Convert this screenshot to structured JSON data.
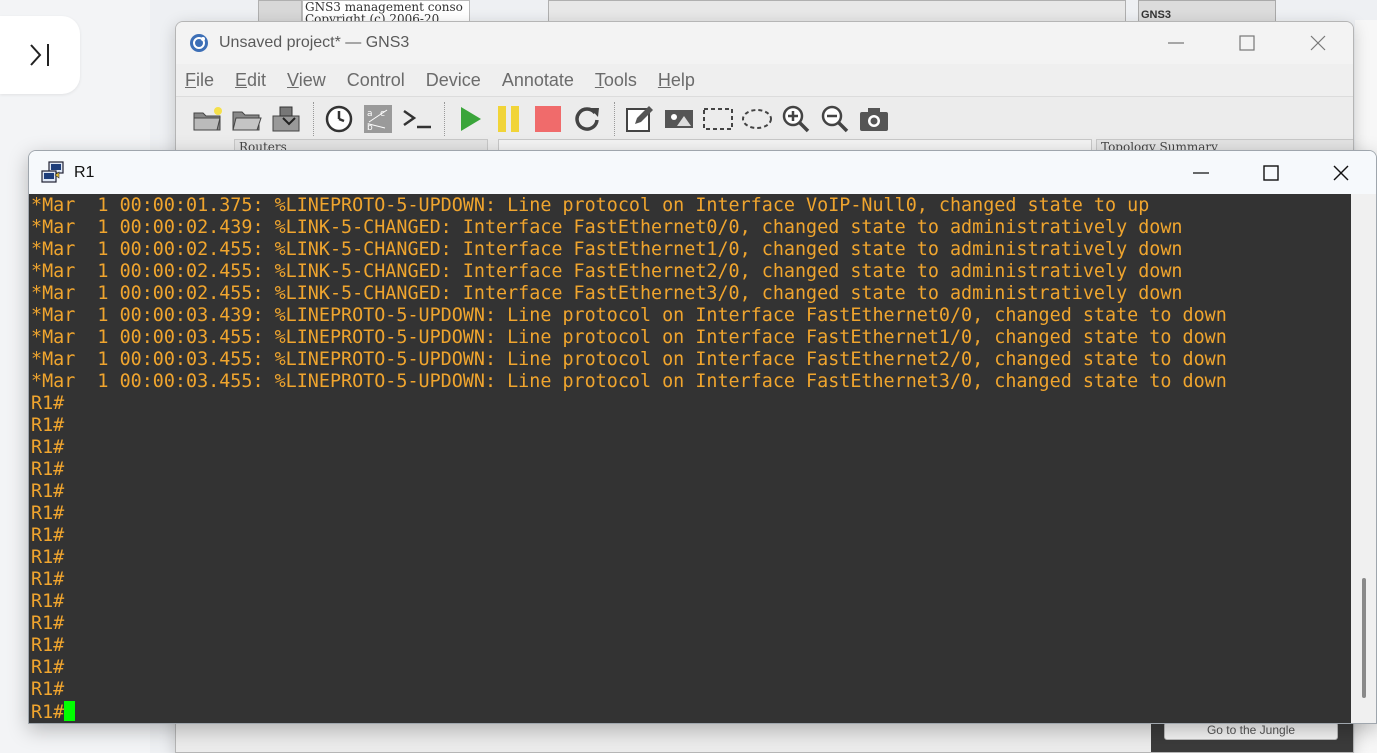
{
  "background": {
    "console_snippet_lines": [
      "GNS3 management conso",
      "Copyright (c) 2006-20"
    ],
    "gns3_badge": "GNS3",
    "sidebar_toggle_icon": "collapse-panel-icon"
  },
  "gns3_window": {
    "title": "Unsaved project* — GNS3",
    "menu": [
      {
        "first": "F",
        "rest": "ile"
      },
      {
        "first": "E",
        "rest": "dit"
      },
      {
        "first": "V",
        "rest": "iew"
      },
      {
        "first": "",
        "rest": "Control"
      },
      {
        "first": "",
        "rest": "Device"
      },
      {
        "first": "",
        "rest": "Annotate"
      },
      {
        "first": "T",
        "rest": "ools"
      },
      {
        "first": "H",
        "rest": "elp"
      }
    ],
    "toolbar_icons": [
      "new-project-icon",
      "open-project-icon",
      "save-project-icon",
      "snapshot-icon",
      "show-interface-labels-icon",
      "console-all-icon",
      "start-all-icon",
      "suspend-all-icon",
      "stop-all-icon",
      "reload-all-icon",
      "add-note-icon",
      "insert-image-icon",
      "draw-rectangle-icon",
      "draw-ellipse-icon",
      "zoom-in-icon",
      "zoom-out-icon",
      "screenshot-icon"
    ],
    "docks": {
      "routers": "Routers",
      "topology_summary": "Topology Summary"
    },
    "jungle_button": "Go to the Jungle",
    "colors": {
      "start": "#3aa53a",
      "suspend": "#f1d438",
      "stop": "#f06b6b"
    }
  },
  "terminal": {
    "title": "R1",
    "lines": [
      "*Mar  1 00:00:01.375: %LINEPROTO-5-UPDOWN: Line protocol on Interface VoIP-Null0, changed state to up",
      "*Mar  1 00:00:02.439: %LINK-5-CHANGED: Interface FastEthernet0/0, changed state to administratively down",
      "*Mar  1 00:00:02.455: %LINK-5-CHANGED: Interface FastEthernet1/0, changed state to administratively down",
      "*Mar  1 00:00:02.455: %LINK-5-CHANGED: Interface FastEthernet2/0, changed state to administratively down",
      "*Mar  1 00:00:02.455: %LINK-5-CHANGED: Interface FastEthernet3/0, changed state to administratively down",
      "*Mar  1 00:00:03.439: %LINEPROTO-5-UPDOWN: Line protocol on Interface FastEthernet0/0, changed state to down",
      "*Mar  1 00:00:03.455: %LINEPROTO-5-UPDOWN: Line protocol on Interface FastEthernet1/0, changed state to down",
      "*Mar  1 00:00:03.455: %LINEPROTO-5-UPDOWN: Line protocol on Interface FastEthernet2/0, changed state to down",
      "*Mar  1 00:00:03.455: %LINEPROTO-5-UPDOWN: Line protocol on Interface FastEthernet3/0, changed state to down",
      "R1#",
      "R1#",
      "R1#",
      "R1#",
      "R1#",
      "R1#",
      "R1#",
      "R1#",
      "R1#",
      "R1#",
      "R1#",
      "R1#",
      "R1#",
      "R1#"
    ],
    "prompt": "R1#",
    "colors": {
      "background": "#333333",
      "text": "#f0a52e",
      "cursor": "#00ff00"
    }
  }
}
